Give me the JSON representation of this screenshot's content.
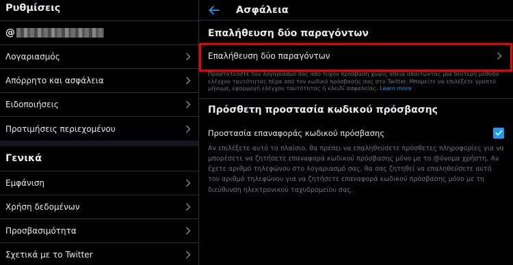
{
  "left": {
    "title": "Ρυθμίσεις",
    "handle_prefix": "@",
    "items": [
      {
        "label": "Λογαριασμός"
      },
      {
        "label": "Απόρρητο και ασφάλεια"
      },
      {
        "label": "Ειδοποιήσεις"
      },
      {
        "label": "Προτιμήσεις περιεχομένου"
      }
    ],
    "general_title": "Γενικά",
    "general_items": [
      {
        "label": "Εμφάνιση"
      },
      {
        "label": "Χρήση δεδομένων"
      },
      {
        "label": "Προσβασιμότητα"
      },
      {
        "label": "Σχετικά με το Twitter"
      }
    ]
  },
  "right": {
    "title": "Ασφάλεια",
    "tfa_section_title": "Επαλήθευση δύο παραγόντων",
    "tfa_item_label": "Επαλήθευση δύο παραγόντων",
    "tfa_help": "Προστατεύστε τον λογαριασμό σας από τυχόν πρόσβαση χωρίς άδεια απαιτώντας μια δεύτερη μέθοδο ελέγχου ταυτότητας πέρα από τον κωδικό πρόσβασής σας στο Twitter. Μπορείτε να επιλέξετε γραπτό μήνυμα, εφαρμογή ελέγχου ταυτότητας ή κλειδί ασφαλείας.",
    "tfa_learn_more": "Learn more",
    "pw_section_title": "Πρόσθετη προστασία κωδικού πρόσβασης",
    "pw_reset_label": "Προστασία επαναφοράς κωδικού πρόσβασης",
    "pw_reset_checked": true,
    "pw_description": "Αν επιλέξετε αυτό το πλαίσιο, θα πρέπει να επαληθεύσετε πρόσθετες πληροφορίες για να μπορέσετε να ζητήσετε επαναφορά κωδικού πρόσβασης μόνο με το @όνομα χρήστη. Αν έχετε αριθμό τηλεφώνου στο λογαριασμό σας, θα σας ζητηθεί να επαληθεύσετε αυτό τον αριθμό τηλεφώνου για να ζητήσετε επαναφορά κωδικού πρόσβασης μόνο με τη διεύθυνση ηλεκτρονικού ταχυδρομείου σας."
  },
  "colors": {
    "accent": "#1d9bf0",
    "highlight": "#e00000",
    "background": "#000000",
    "separator": "#2f3336"
  }
}
